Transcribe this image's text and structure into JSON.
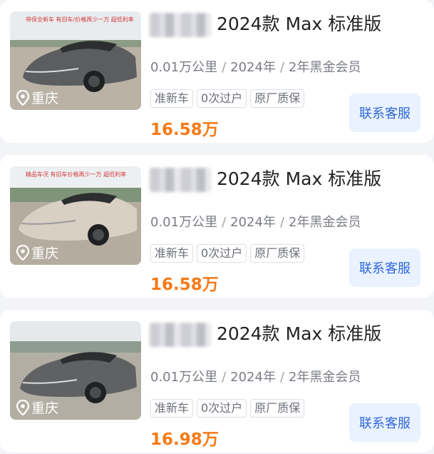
{
  "listings": [
    {
      "title": "2024款 Max 标准版",
      "mileage": "0.01万公里",
      "year": "2024年",
      "membership": "2年黑金会员",
      "tags": [
        "准新车",
        "0次过户",
        "原厂质保"
      ],
      "price": "16.58万",
      "location": "重庆",
      "contact_label": "联系客服",
      "car_color": "#5b5d5f",
      "thumb_tagline": "带保全新车   有旧车/价格再少一万   超低利率"
    },
    {
      "title": "2024款 Max 标准版",
      "mileage": "0.01万公里",
      "year": "2024年",
      "membership": "2年黑金会员",
      "tags": [
        "准新车",
        "0次过户",
        "原厂质保"
      ],
      "price": "16.58万",
      "location": "重庆",
      "contact_label": "联系客服",
      "car_color": "#d9d0c4",
      "thumb_tagline": "精品车况   有旧车价格再少一万   超低利率"
    },
    {
      "title": "2024款 Max 标准版",
      "mileage": "0.01万公里",
      "year": "2024年",
      "membership": "2年黑金会员",
      "tags": [
        "准新车",
        "0次过户",
        "原厂质保"
      ],
      "price": "16.98万",
      "location": "重庆",
      "contact_label": "联系客服",
      "car_color": "#5f6163",
      "thumb_tagline": ""
    }
  ],
  "separator": "/",
  "icons": {
    "location": "location-pin-icon"
  },
  "colors": {
    "price": "#f57a17",
    "contact_text": "#2e67d8",
    "contact_bg": "#eaf2ff"
  }
}
